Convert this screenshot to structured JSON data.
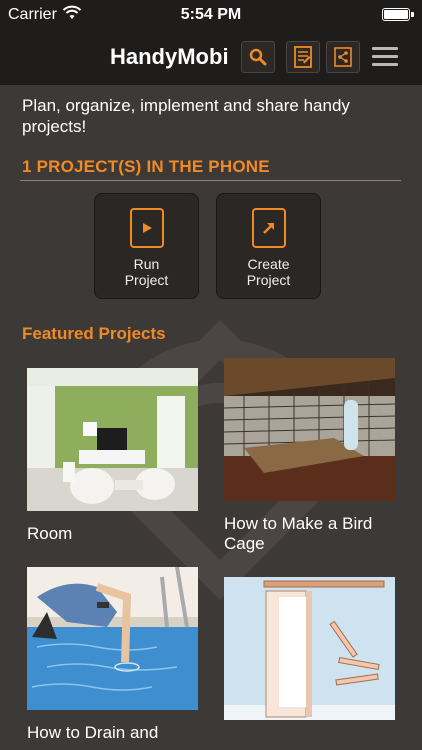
{
  "status_bar": {
    "carrier": "Carrier",
    "time": "5:54 PM",
    "battery_level": 1.0
  },
  "nav": {
    "title": "HandyMobi",
    "icons": [
      "search-icon",
      "document-icon",
      "share-icon",
      "menu-icon"
    ],
    "accent_color": "#f08a24"
  },
  "tagline": "Plan, organize, implement and share handy projects!",
  "projects_header": "1 PROJECT(S) IN THE PHONE",
  "actions": {
    "run": {
      "line1": "Run",
      "line2": "Project",
      "icon": "play-icon"
    },
    "create": {
      "line1": "Create",
      "line2": "Project",
      "icon": "arrow-up-right-icon"
    }
  },
  "featured_header": "Featured Projects",
  "featured": [
    {
      "title": "Room",
      "image": "living-room-photo"
    },
    {
      "title": "How to Make a Bird Cage",
      "image": "bird-cage-render"
    },
    {
      "title": "How to Drain and",
      "image": "pool-drain-illustration"
    },
    {
      "title": "",
      "image": "sliding-door-illustration"
    }
  ]
}
